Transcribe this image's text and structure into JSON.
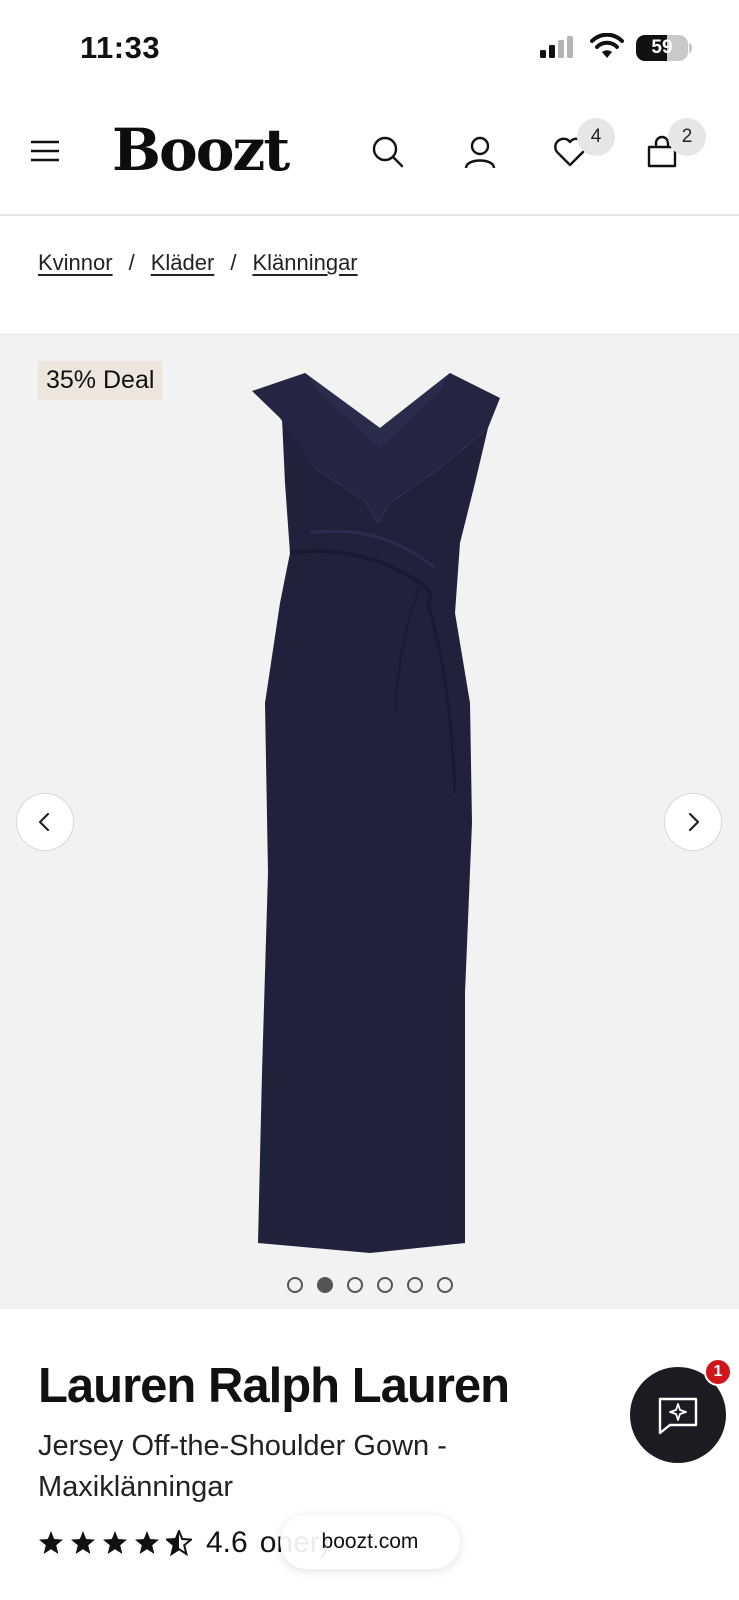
{
  "status_bar": {
    "time": "11:33",
    "battery": "59",
    "battery_fraction": 0.59
  },
  "header": {
    "logo": "Boozt",
    "wishlist_count": "4",
    "cart_count": "2",
    "icons": [
      "menu-icon",
      "search-icon",
      "account-icon",
      "heart-icon",
      "bag-icon"
    ]
  },
  "breadcrumb": {
    "items": [
      "Kvinnor",
      "Kläder",
      "Klänningar"
    ],
    "separator": "/"
  },
  "gallery": {
    "deal_label": "35% Deal",
    "image_count": 6,
    "active_index": 1,
    "background": "#f2f2f2",
    "dress_color": "#20213b"
  },
  "product": {
    "brand": "Lauren Ralph Lauren",
    "name": "Jersey Off-the-Shoulder Gown - Maxiklänningar",
    "rating_value": "4.6",
    "rating_stars": 4.5,
    "rating_count_text": "oner)"
  },
  "chat": {
    "badge": "1"
  },
  "browser": {
    "url": "boozt.com"
  },
  "colors": {
    "deal_bg": "#ece6dc",
    "chat_bg": "#1e1a22",
    "badge_red": "#d0161c"
  }
}
